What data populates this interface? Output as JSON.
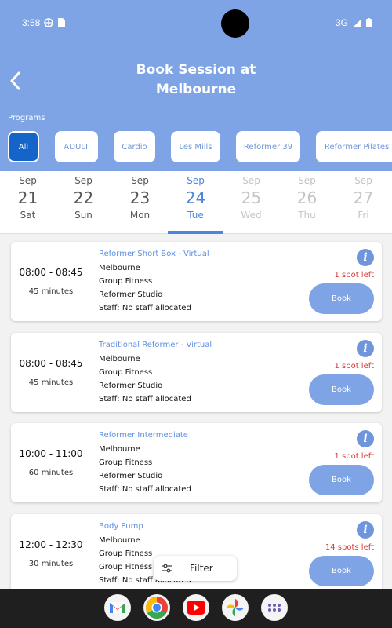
{
  "status": {
    "time": "3:58",
    "network": "3G"
  },
  "header": {
    "title_line1": "Book Session at",
    "title_line2": "Melbourne",
    "programs_label": "Programs"
  },
  "programs": [
    "All",
    "ADULT",
    "Cardio",
    "Les Mills",
    "Reformer 39",
    "Reformer Pilates"
  ],
  "days": [
    {
      "month": "Sep",
      "date": "21",
      "weekday": "Sat"
    },
    {
      "month": "Sep",
      "date": "22",
      "weekday": "Sun"
    },
    {
      "month": "Sep",
      "date": "23",
      "weekday": "Mon"
    },
    {
      "month": "Sep",
      "date": "24",
      "weekday": "Tue"
    },
    {
      "month": "Sep",
      "date": "25",
      "weekday": "Wed"
    },
    {
      "month": "Sep",
      "date": "26",
      "weekday": "Thu"
    },
    {
      "month": "Sep",
      "date": "27",
      "weekday": "Fri"
    }
  ],
  "sessions": [
    {
      "time": "08:00 - 08:45",
      "duration": "45 minutes",
      "name": "Reformer Short Box - Virtual",
      "location": "Melbourne",
      "category": "Group Fitness",
      "room": "Reformer Studio",
      "staff": "Staff: No staff allocated",
      "spots": "1 spot left",
      "book": "Book"
    },
    {
      "time": "08:00 - 08:45",
      "duration": "45 minutes",
      "name": "Traditional Reformer - Virtual",
      "location": "Melbourne",
      "category": "Group Fitness",
      "room": "Reformer Studio",
      "staff": "Staff: No staff allocated",
      "spots": "1 spot left",
      "book": "Book"
    },
    {
      "time": "10:00 - 11:00",
      "duration": "60 minutes",
      "name": "Reformer Intermediate",
      "location": "Melbourne",
      "category": "Group Fitness",
      "room": "Reformer Studio",
      "staff": "Staff: No staff allocated",
      "spots": "1 spot left",
      "book": "Book"
    },
    {
      "time": "12:00 - 12:30",
      "duration": "30 minutes",
      "name": "Body Pump",
      "location": "Melbourne",
      "category": "Group Fitness",
      "room": "Group Fitness",
      "staff": "Staff: No staff allocated",
      "spots": "14 spots left",
      "book": "Book"
    }
  ],
  "filter": {
    "label": "Filter"
  },
  "dock": [
    "gmail-icon",
    "chrome-icon",
    "youtube-icon",
    "photos-icon",
    "apps-icon"
  ],
  "colors": {
    "header": "#7ea4e6",
    "accent": "#4b86de",
    "selected_chip": "#1565c8",
    "spots": "#d73a3a"
  }
}
